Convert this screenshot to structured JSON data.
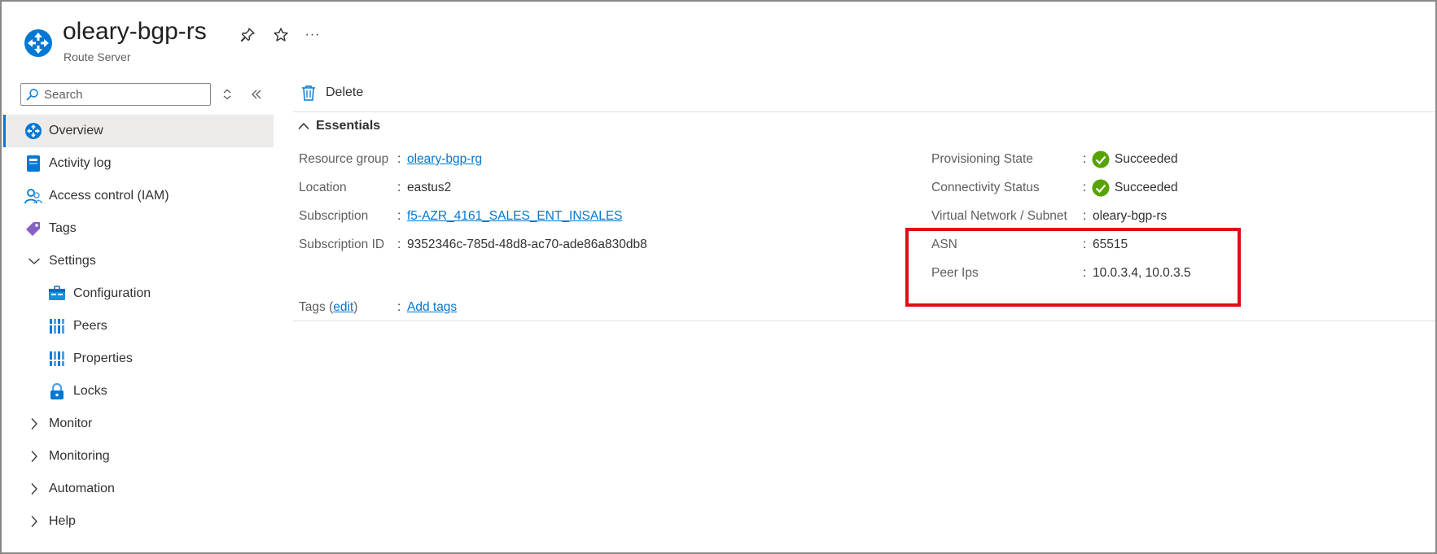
{
  "header": {
    "title": "oleary-bgp-rs",
    "subtitle": "Route Server",
    "icons": [
      "route-server-icon",
      "pin-icon",
      "star-icon",
      "more-icon"
    ],
    "more_label": "···"
  },
  "sidebar": {
    "search_placeholder": "Search",
    "items": [
      {
        "label": "Overview",
        "icon": "overview-icon"
      },
      {
        "label": "Activity log",
        "icon": "activity-log-icon"
      },
      {
        "label": "Access control (IAM)",
        "icon": "iam-icon"
      },
      {
        "label": "Tags",
        "icon": "tag-icon"
      },
      {
        "label": "Settings",
        "icon": "chevron-down-icon"
      },
      {
        "label": "Configuration",
        "icon": "configuration-icon"
      },
      {
        "label": "Peers",
        "icon": "peers-icon"
      },
      {
        "label": "Properties",
        "icon": "properties-icon"
      },
      {
        "label": "Locks",
        "icon": "lock-icon"
      },
      {
        "label": "Monitor",
        "icon": "chevron-right-icon"
      },
      {
        "label": "Monitoring",
        "icon": "chevron-right-icon"
      },
      {
        "label": "Automation",
        "icon": "chevron-right-icon"
      },
      {
        "label": "Help",
        "icon": "chevron-right-icon"
      }
    ]
  },
  "toolbar": {
    "delete_label": "Delete"
  },
  "essentials": {
    "label": "Essentials",
    "separator": ":",
    "left": [
      {
        "label": "Resource group",
        "value": "oleary-bgp-rg"
      },
      {
        "label": "Location",
        "value": "eastus2"
      },
      {
        "label": "Subscription",
        "value": "f5-AZR_4161_SALES_ENT_INSALES"
      },
      {
        "label": "Subscription ID",
        "value": "9352346c-785d-48d8-ac70-ade86a830db8"
      }
    ],
    "right": [
      {
        "label": "Provisioning State",
        "value": "Succeeded"
      },
      {
        "label": "Connectivity Status",
        "value": "Succeeded"
      },
      {
        "label": "Virtual Network / Subnet",
        "value": "oleary-bgp-rs"
      },
      {
        "label": "ASN",
        "value": "65515"
      },
      {
        "label": "Peer Ips",
        "value": "10.0.3.4, 10.0.3.5"
      }
    ],
    "tags": {
      "label": "Tags",
      "open_paren": "(",
      "edit": "edit",
      "close_paren": ")",
      "value": "Add tags"
    }
  },
  "colors": {
    "accent": "#0078d4",
    "success": "#57a300",
    "highlight_border": "#e00d13",
    "selected_bg": "#edebe9"
  }
}
